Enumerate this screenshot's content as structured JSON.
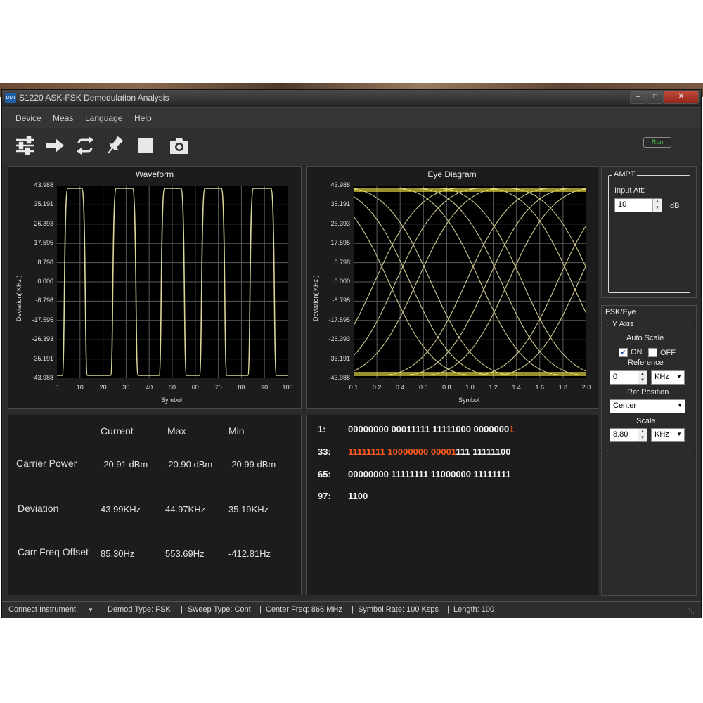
{
  "window": {
    "title": "S1220 ASK-FSK Demodulation Analysis",
    "icon_text": "DMI"
  },
  "menu": [
    "Device",
    "Meas",
    "Language",
    "Help"
  ],
  "toolbar": {
    "icons": [
      "settings-sliders-icon",
      "arrow-right-icon",
      "repeat-icon",
      "pin-icon",
      "stop-icon",
      "camera-icon"
    ],
    "run_status": "Run",
    "run_color": "#49d44a"
  },
  "waveform": {
    "title": "Waveform",
    "ylabel": "Deviation( KHz )",
    "xlabel": "Symbol",
    "yticks": [
      "43.988",
      "35.191",
      "26.393",
      "17.595",
      "8.798",
      "0.000",
      "-8.798",
      "-17.595",
      "-26.393",
      "-35.191",
      "-43.988"
    ],
    "xticks": [
      "0",
      "10",
      "20",
      "30",
      "40",
      "50",
      "60",
      "70",
      "80",
      "90",
      "100"
    ]
  },
  "eye": {
    "title": "Eye Diagram",
    "ylabel": "Deviation( KHz )",
    "xlabel": "Symbol",
    "yticks": [
      "43.988",
      "35.191",
      "26.393",
      "17.595",
      "8.798",
      "0.000",
      "-8.798",
      "-17.595",
      "-26.393",
      "-35.191",
      "-43.988"
    ],
    "xticks": [
      "0.1",
      "0.2",
      "0.4",
      "0.6",
      "0.8",
      "1.0",
      "1.2",
      "1.4",
      "1.6",
      "1.8",
      "2.0"
    ]
  },
  "measurements": {
    "headers": [
      "Current",
      "Max",
      "Min"
    ],
    "rows": [
      {
        "label": "Carrier Power",
        "current": "-20.91 dBm",
        "max": "-20.90 dBm",
        "min": "-20.99 dBm"
      },
      {
        "label": "Deviation",
        "current": "43.99KHz",
        "max": "44.97KHz",
        "min": "35.19KHz"
      },
      {
        "label": "Carr Freq Offset",
        "current": "85.30Hz",
        "max": "553.69Hz",
        "min": "-412.81Hz"
      }
    ]
  },
  "bits": {
    "rows": [
      {
        "index": "1:",
        "normal": "00000000 00011111 11111000 0000000",
        "highlight": "1",
        "rest": ""
      },
      {
        "index": "33:",
        "normal": "",
        "highlight": "11111111 10000000 00001",
        "rest": "111 11111100"
      },
      {
        "index": "65:",
        "normal": "00000000 11111111 11000000 11111111",
        "highlight": "",
        "rest": ""
      },
      {
        "index": "97:",
        "normal": "1100",
        "highlight": "",
        "rest": ""
      }
    ],
    "highlight_color": "#ff5a1e"
  },
  "ampt": {
    "group": "AMPT",
    "input_att_label": "Input Att:",
    "input_att_value": "10",
    "unit": "dB"
  },
  "fsk": {
    "section": "FSK/Eye",
    "group": "Y Axis",
    "auto_scale": "Auto Scale",
    "on_label": "ON",
    "off_label": "OFF",
    "on_checked": true,
    "reference_label": "Reference",
    "reference_value": "0",
    "reference_unit": "KHz",
    "ref_position_label": "Ref Position",
    "ref_position_value": "Center",
    "scale_label": "Scale",
    "scale_value": "8.80",
    "scale_unit": "KHz"
  },
  "status": {
    "connect": "Connect Instrument:",
    "demod": "Demod Type:  FSK",
    "sweep": "Sweep Type:  Cont",
    "center": "Center Freq:  866 MHz",
    "rate": "Symbol Rate:  100 Ksps",
    "length": "Length:  100"
  }
}
